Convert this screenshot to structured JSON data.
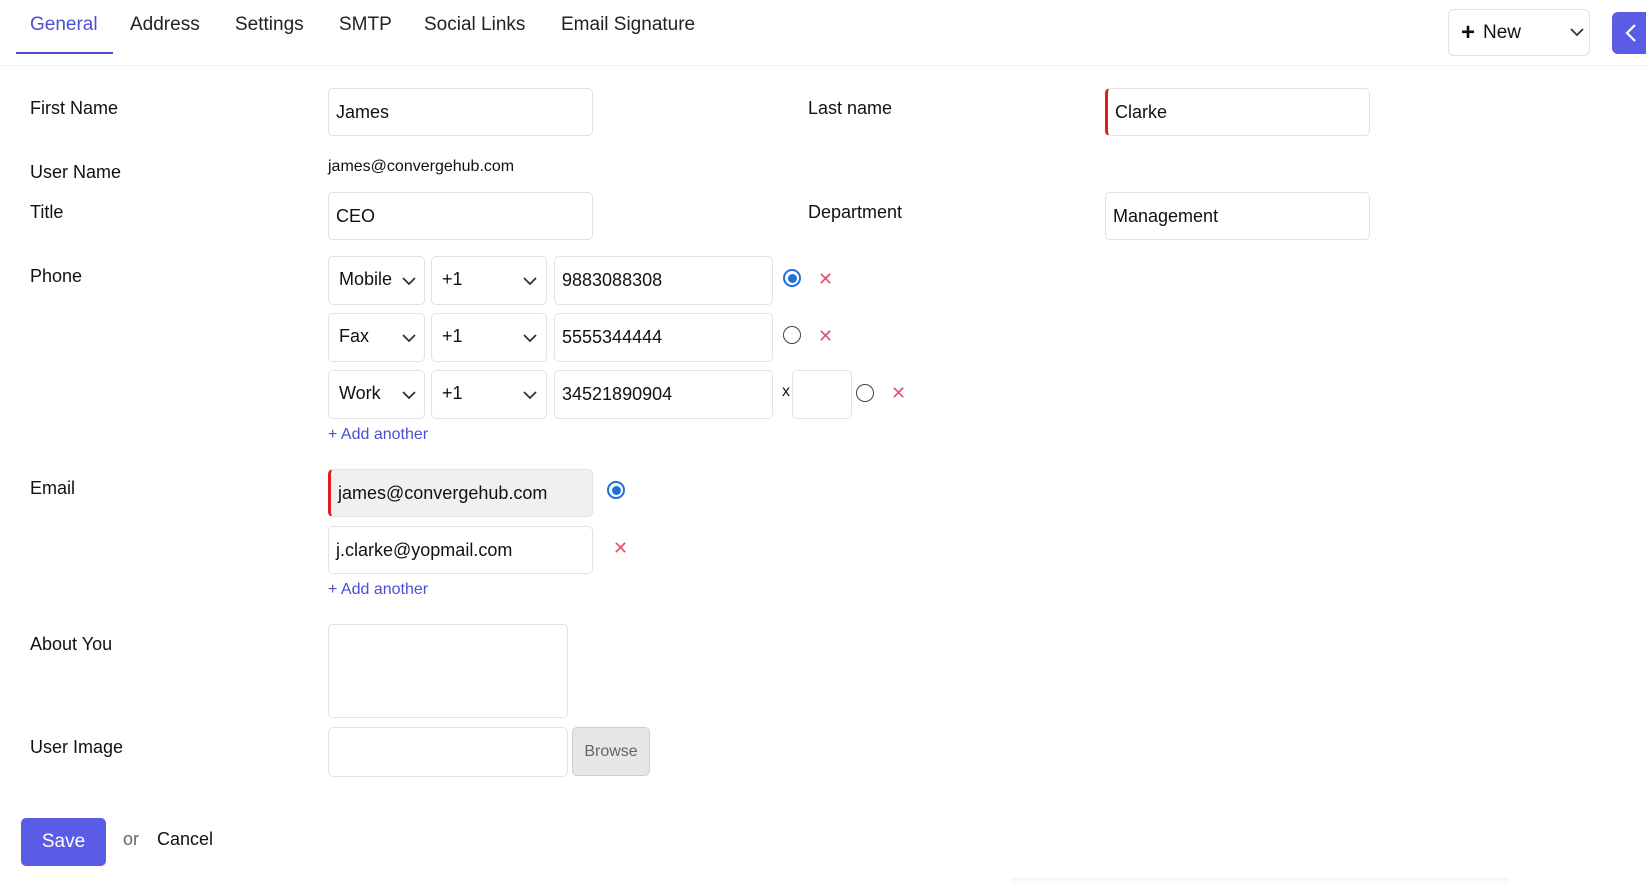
{
  "tabs": [
    "General",
    "Address",
    "Settings",
    "SMTP",
    "Social Links",
    "Email Signature"
  ],
  "header": {
    "new_label": "New"
  },
  "form": {
    "first_name_label": "First Name",
    "first_name_value": "James",
    "last_name_label": "Last name",
    "last_name_value": "Clarke",
    "user_name_label": "User Name",
    "user_name_value": "james@convergehub.com",
    "title_label": "Title",
    "title_value": "CEO",
    "department_label": "Department",
    "department_value": "Management",
    "phone_label": "Phone",
    "phones": [
      {
        "type": "Mobile",
        "code": "+1",
        "number": "9883088308",
        "primary": true
      },
      {
        "type": "Fax",
        "code": "+1",
        "number": "5555344444",
        "primary": false
      },
      {
        "type": "Work",
        "code": "+1",
        "number": "34521890904",
        "ext_label": "x",
        "ext": "",
        "primary": false
      }
    ],
    "add_another_label": "+ Add another",
    "email_label": "Email",
    "emails": [
      {
        "value": "james@convergehub.com",
        "primary": true
      },
      {
        "value": "j.clarke@yopmail.com",
        "primary": false
      }
    ],
    "about_label": "About You",
    "about_value": "",
    "user_image_label": "User Image",
    "browse_label": "Browse"
  },
  "actions": {
    "save_label": "Save",
    "or_label": "or",
    "cancel_label": "Cancel"
  },
  "colors": {
    "accent": "#5b5ce6",
    "link": "#4b4fd1",
    "required": "#e21b1b",
    "radio": "#1f6fd6",
    "delete": "#e05470"
  }
}
